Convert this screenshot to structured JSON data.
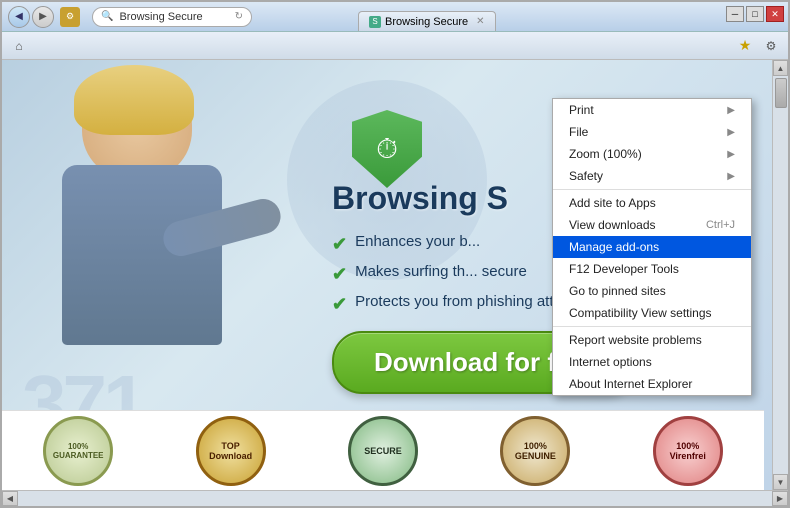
{
  "window": {
    "title": "Browsing Secure",
    "tab_label": "Browsing Secure",
    "min_label": "─",
    "max_label": "□",
    "close_label": "✕"
  },
  "nav": {
    "back_label": "◀",
    "forward_label": "▶",
    "reload_label": "↻",
    "address": "Browsing Secure"
  },
  "toolbar": {
    "home_label": "⌂",
    "favorites_label": "☆",
    "settings_label": "⚙"
  },
  "page": {
    "title": "Browsing S",
    "feature1": "Enhances your b...",
    "feature2": "Makes surfing th... secure",
    "feature3": "Protects you from phishing attacts",
    "download_btn": "Download for free"
  },
  "badges": [
    {
      "label": "100%\nGUARANTEE",
      "type": "guarantee"
    },
    {
      "label": "TOP\nDownload",
      "type": "top"
    },
    {
      "label": "SECURE",
      "type": "secure"
    },
    {
      "label": "100%\nGENUINE",
      "type": "genuine"
    },
    {
      "label": "100%\nVirenfrei",
      "type": "virusfrei"
    }
  ],
  "menu": {
    "items": [
      {
        "label": "Print",
        "shortcut": "",
        "arrow": "▶",
        "id": "print"
      },
      {
        "label": "File",
        "shortcut": "",
        "arrow": "▶",
        "id": "file"
      },
      {
        "label": "Zoom (100%)",
        "shortcut": "",
        "arrow": "▶",
        "id": "zoom"
      },
      {
        "label": "Safety",
        "shortcut": "",
        "arrow": "▶",
        "id": "safety"
      },
      {
        "label": "Add site to Apps",
        "shortcut": "",
        "arrow": "",
        "id": "add-site"
      },
      {
        "label": "View downloads",
        "shortcut": "Ctrl+J",
        "arrow": "",
        "id": "view-downloads"
      },
      {
        "label": "Manage add-ons",
        "shortcut": "",
        "arrow": "",
        "id": "manage-addons",
        "highlighted": true
      },
      {
        "label": "F12 Developer Tools",
        "shortcut": "",
        "arrow": "",
        "id": "dev-tools"
      },
      {
        "label": "Go to pinned sites",
        "shortcut": "",
        "arrow": "",
        "id": "pinned-sites"
      },
      {
        "label": "Compatibility View settings",
        "shortcut": "",
        "arrow": "",
        "id": "compat-view"
      },
      {
        "label": "Report website problems",
        "shortcut": "",
        "arrow": "",
        "id": "report-problems"
      },
      {
        "label": "Internet options",
        "shortcut": "",
        "arrow": "",
        "id": "internet-options"
      },
      {
        "label": "About Internet Explorer",
        "shortcut": "",
        "arrow": "",
        "id": "about-ie"
      }
    ]
  }
}
